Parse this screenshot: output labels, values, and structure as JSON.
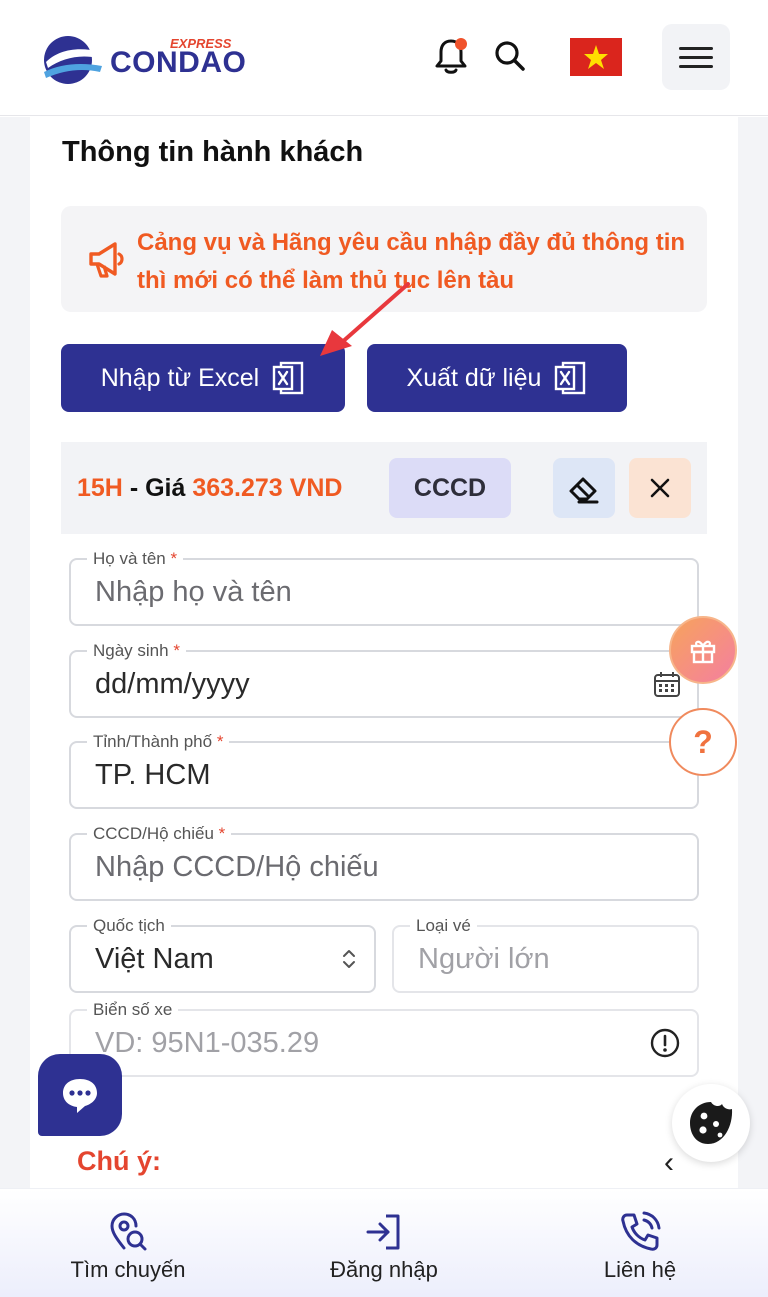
{
  "header": {
    "brand": "CONDAO",
    "brand_sub": "EXPRESS",
    "icons": [
      "bell-icon",
      "search-icon",
      "vietnam-flag-icon",
      "hamburger-menu-icon"
    ]
  },
  "passenger_section": {
    "title": "Thông tin hành khách",
    "notice": "Cảng vụ và Hãng yêu cầu nhập đầy đủ thông tin thì mới có thể làm thủ tục lên tàu",
    "import_label": "Nhập từ Excel",
    "export_label": "Xuất dữ liệu"
  },
  "passenger": {
    "seat": "15H",
    "price_prefix": " - Giá ",
    "price": "363.273 VND",
    "id_type": "CCCD"
  },
  "form": {
    "name": {
      "label": "Họ và tên",
      "placeholder": "Nhập họ và tên"
    },
    "dob": {
      "label": "Ngày sinh",
      "placeholder": "dd/mm/yyyy"
    },
    "city": {
      "label": "Tỉnh/Thành phố",
      "value": "TP. HCM"
    },
    "id_number": {
      "label": "CCCD/Hộ chiếu",
      "placeholder": "Nhập CCCD/Hộ chiếu"
    },
    "nationality": {
      "label": "Quốc tịch",
      "value": "Việt Nam"
    },
    "ticket_type": {
      "label": "Loại vé",
      "value": "Người lớn"
    },
    "plate": {
      "label": "Biển số xe",
      "placeholder": "VD: 95N1-035.29"
    },
    "required_mark": "*"
  },
  "note": {
    "label": "Chú ý:",
    "chevron": "‹"
  },
  "fab": {
    "help": "?"
  },
  "bottom_nav": {
    "find_trip": "Tìm chuyến",
    "login": "Đăng nhập",
    "contact": "Liên hệ"
  },
  "colors": {
    "brand_navy": "#2e3192",
    "accent_orange": "#f05a22",
    "required_red": "#e4452f"
  }
}
